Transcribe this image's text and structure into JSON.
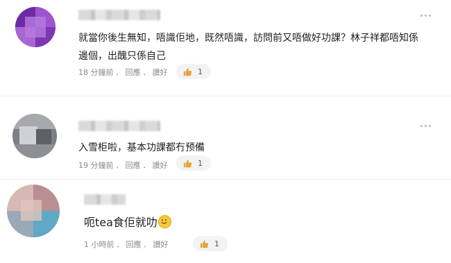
{
  "comments": [
    {
      "text_line1": "就當你後生無知，唔識佢地，既然唔識，訪問前又唔做好功課？林子祥都唔知係",
      "text_line2": "邊個，出醜只係自己",
      "time": "18 分鐘前",
      "reply_label": "回應",
      "like_label": "讚好",
      "like_count": "1"
    },
    {
      "text_line1": "入雪柜啦，基本功課都冇预備",
      "time": "19 分鐘前",
      "reply_label": "回應",
      "like_label": "讚好",
      "like_count": "1"
    },
    {
      "text_line1": "呃tea食佢就叻",
      "time": "1 小時前",
      "reply_label": "回應",
      "like_label": "讚好",
      "like_count": "1"
    }
  ],
  "separator": "．",
  "colors": {
    "meta_text": "#8a8a8a",
    "like_pill_bg": "#f3f3f3",
    "thumb_icon": "#e2a33b"
  },
  "icons": {
    "more": "more-horizontal-icon",
    "like": "thumbs-up-icon",
    "emoji": "smiling-face-emoji-icon"
  }
}
